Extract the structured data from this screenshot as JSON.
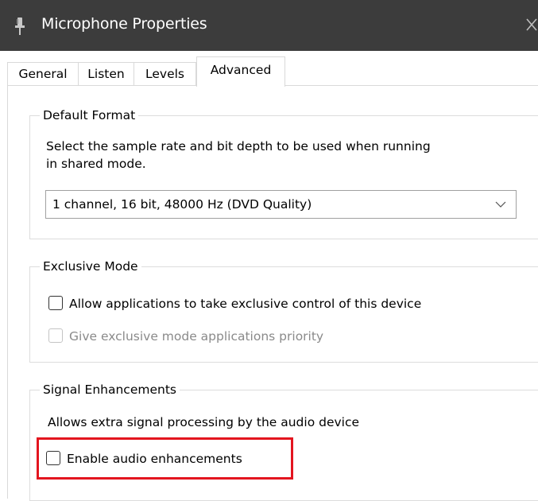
{
  "window": {
    "title": "Microphone Properties",
    "icon": "microphone-icon",
    "close_icon": "close-icon"
  },
  "tabs": [
    {
      "label": "General"
    },
    {
      "label": "Listen"
    },
    {
      "label": "Levels"
    },
    {
      "label": "Advanced",
      "active": true
    }
  ],
  "default_format": {
    "group_label": "Default Format",
    "description_line1": "Select the sample rate and bit depth to be used when running",
    "description_line2": "in shared mode.",
    "selected_format": "1 channel, 16 bit, 48000 Hz (DVD Quality)"
  },
  "exclusive_mode": {
    "group_label": "Exclusive Mode",
    "allow_exclusive_label": "Allow applications to take exclusive control of this device",
    "allow_exclusive_checked": false,
    "priority_label": "Give exclusive mode applications priority",
    "priority_enabled": false,
    "priority_checked": false
  },
  "signal_enhancements": {
    "group_label": "Signal Enhancements",
    "description": "Allows extra signal processing by the audio device",
    "enable_label": "Enable audio enhancements",
    "enable_checked": false
  },
  "colors": {
    "titlebar": "#3c3c3c",
    "highlight": "#e3151f"
  }
}
